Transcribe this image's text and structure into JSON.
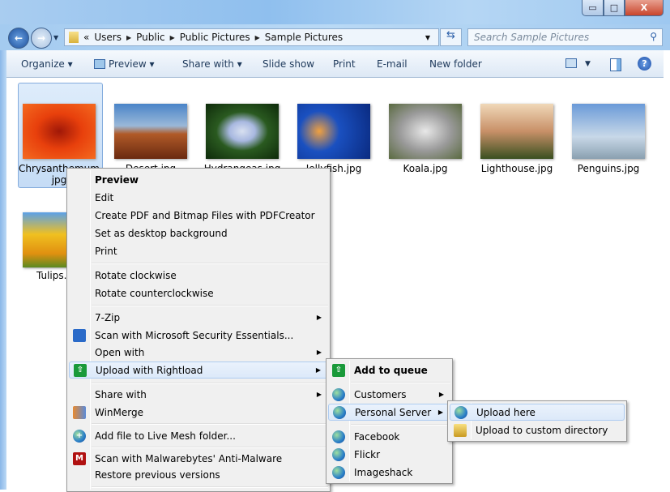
{
  "window": {
    "minimize": "▭",
    "maximize": "□",
    "close": "X"
  },
  "nav": {
    "back": "←",
    "forward": "→",
    "breadcrumb": [
      "«",
      "Users",
      "Public",
      "Public Pictures",
      "Sample Pictures"
    ],
    "search_placeholder": "Search Sample Pictures"
  },
  "toolbar": {
    "organize": "Organize",
    "preview": "Preview",
    "share_with": "Share with",
    "slide_show": "Slide show",
    "print": "Print",
    "email": "E-mail",
    "new_folder": "New folder"
  },
  "files": [
    {
      "name": "Chrysanthemum.jpg",
      "line1": "Chrysanthemum",
      "line2": "jpg"
    },
    {
      "name": "Desert.jpg"
    },
    {
      "name": "Hydrangeas.jpg"
    },
    {
      "name": "Jellyfish.jpg"
    },
    {
      "name": "Koala.jpg"
    },
    {
      "name": "Lighthouse.jpg"
    },
    {
      "name": "Penguins.jpg"
    },
    {
      "name": "Tulips.jpg"
    }
  ],
  "context_menu": {
    "items": [
      "Preview",
      "Edit",
      "Create PDF and Bitmap Files with PDFCreator",
      "Set as desktop background",
      "Print",
      "Rotate clockwise",
      "Rotate counterclockwise",
      "7-Zip",
      "Scan with Microsoft Security Essentials...",
      "Open with",
      "Upload with Rightload",
      "Share with",
      "WinMerge",
      "Add file to Live Mesh folder...",
      "Scan with Malwarebytes' Anti-Malware",
      "Restore previous versions"
    ]
  },
  "rightload_menu": {
    "items": [
      "Add to queue",
      "Customers",
      "Personal Server",
      "Facebook",
      "Flickr",
      "Imageshack"
    ]
  },
  "server_menu": {
    "items": [
      "Upload here",
      "Upload to custom directory"
    ]
  }
}
